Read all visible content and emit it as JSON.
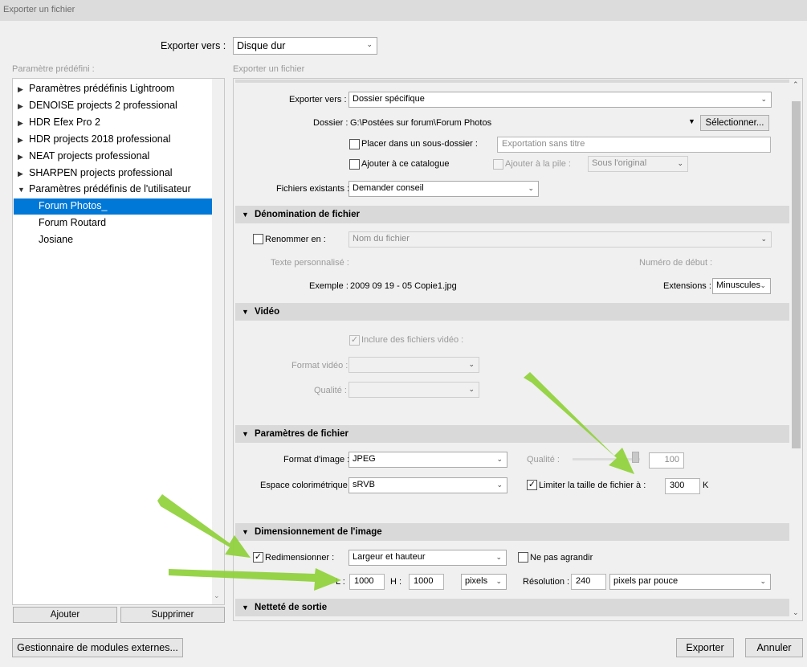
{
  "window": {
    "title": "Exporter un fichier"
  },
  "export_to": {
    "label": "Exporter vers :",
    "value": "Disque dur"
  },
  "presets": {
    "header": "Paramètre prédéfini :",
    "items": [
      {
        "label": "Paramètres prédéfinis Lightroom"
      },
      {
        "label": "DENOISE projects 2 professional"
      },
      {
        "label": "HDR Efex Pro 2"
      },
      {
        "label": "HDR projects 2018 professional"
      },
      {
        "label": "NEAT projects professional"
      },
      {
        "label": "SHARPEN projects professional"
      },
      {
        "label": "Paramètres prédéfinis de l'utilisateur"
      }
    ],
    "user_items": [
      {
        "label": "Forum Photos_"
      },
      {
        "label": "Forum Routard"
      },
      {
        "label": "Josiane"
      }
    ],
    "add_label": "Ajouter",
    "remove_label": "Supprimer"
  },
  "panel": {
    "header": "Exporter un fichier",
    "location": {
      "export_to_label": "Exporter vers :",
      "export_to_value": "Dossier spécifique",
      "folder_label": "Dossier :",
      "folder_value": "G:\\Postées sur forum\\Forum Photos",
      "choose_label": "Sélectionner...",
      "subfolder_label": "Placer dans un sous-dossier :",
      "subfolder_placeholder": "Exportation sans titre",
      "add_catalog_label": "Ajouter à ce catalogue",
      "add_stack_label": "Ajouter à la pile :",
      "stack_value": "Sous l'original",
      "existing_label": "Fichiers existants :",
      "existing_value": "Demander conseil"
    },
    "naming": {
      "title": "Dénomination de fichier",
      "rename_label": "Renommer en :",
      "rename_value": "Nom du fichier",
      "custom_text_label": "Texte personnalisé :",
      "start_number_label": "Numéro de début :",
      "example_label": "Exemple :",
      "example_value": "2009 09 19 - 05 Copie1.jpg",
      "extensions_label": "Extensions :",
      "extensions_value": "Minuscules"
    },
    "video": {
      "title": "Vidéo",
      "include_label": "Inclure des fichiers vidéo :",
      "format_label": "Format vidéo :",
      "quality_label": "Qualité :"
    },
    "file_settings": {
      "title": "Paramètres de fichier",
      "format_label": "Format d'image :",
      "format_value": "JPEG",
      "quality_label": "Qualité :",
      "quality_value": "100",
      "quality_fraction": 1.0,
      "color_space_label": "Espace colorimétrique :",
      "color_space_value": "sRVB",
      "limit_label": "Limiter la taille de fichier à :",
      "limit_value": "300",
      "limit_unit": "K"
    },
    "sizing": {
      "title": "Dimensionnement de l'image",
      "resize_label": "Redimensionner :",
      "resize_value": "Largeur et hauteur",
      "dont_enlarge_label": "Ne pas agrandir",
      "w_label": "L :",
      "w_value": "1000",
      "h_label": "H :",
      "h_value": "1000",
      "unit_value": "pixels",
      "resolution_label": "Résolution :",
      "resolution_value": "240",
      "resolution_unit": "pixels par pouce"
    },
    "sharpening": {
      "title": "Netteté de sortie"
    }
  },
  "footer": {
    "plugin_manager_label": "Gestionnaire de modules externes...",
    "export_label": "Exporter",
    "cancel_label": "Annuler"
  },
  "colors": {
    "selection": "#0078d7",
    "annotation_arrow": "#8fd13a"
  }
}
